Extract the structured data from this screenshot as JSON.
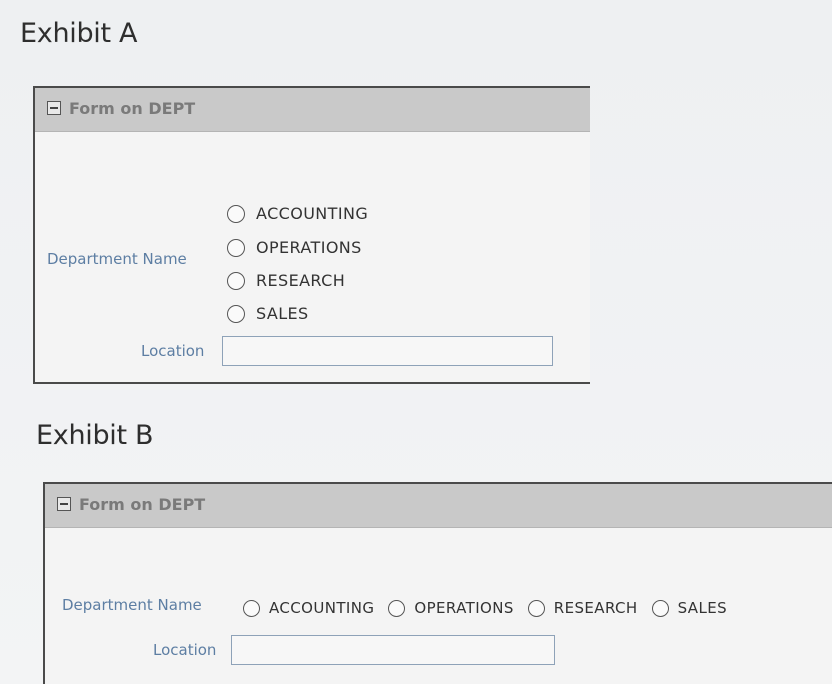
{
  "exhibit_a": {
    "title": "Exhibit A",
    "region_title": "Form on DEPT",
    "department_label": "Department Name",
    "options": [
      "ACCOUNTING",
      "OPERATIONS",
      "RESEARCH",
      "SALES"
    ],
    "location_label": "Location",
    "location_value": ""
  },
  "exhibit_b": {
    "title": "Exhibit B",
    "region_title": "Form on DEPT",
    "department_label": "Department Name",
    "options": [
      "ACCOUNTING",
      "OPERATIONS",
      "RESEARCH",
      "SALES"
    ],
    "location_label": "Location",
    "location_value": ""
  }
}
